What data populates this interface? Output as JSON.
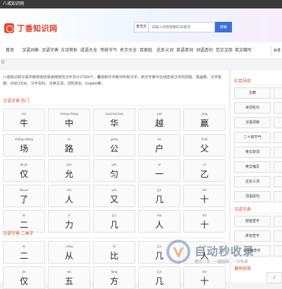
{
  "window": {
    "title": "八戒知识网"
  },
  "header": {
    "logo_text": "丁香知识网",
    "search": {
      "type_label": "查范文",
      "placeholder": "请输入你想搜索的关键词",
      "button_label": "搜索"
    }
  },
  "nav": {
    "items": [
      "首页",
      "汉语词典",
      "汉语字典",
      "古诗赏析",
      "成语大全",
      "传统节气",
      "名字大全",
      "百家姓",
      "近反义词",
      "英语单词",
      "词语造句",
      "范文文库",
      "英文缩写"
    ],
    "right_label": "目录"
  },
  "breadcrumb": "D",
  "main": {
    "intro": "八戒知识网汉语字典频道收录通用规范汉字共计27034个，囊括新华字典中所有汉字。新华字典可在线查阅汉字的拼音、笔画数、汉字笔顺、UNICODE、汉字百科、汉英互译、词性变化、English等。",
    "section1_title": "汉语字典 热门",
    "section2_title": "汉语字典 二画字",
    "grid1": [
      {
        "py": "niú",
        "hz": "牛"
      },
      {
        "py": "zhōng,zhòng",
        "hz": "中"
      },
      {
        "py": "huá,huà,huā",
        "hz": "华"
      },
      {
        "py": "yuè",
        "hz": "越"
      },
      {
        "py": "yíng",
        "hz": "赢"
      },
      {
        "py": "cháng,chǎng",
        "hz": "场"
      },
      {
        "py": "lù",
        "hz": "路"
      },
      {
        "py": "gōng",
        "hz": "公"
      },
      {
        "py": "hù",
        "hz": "户"
      },
      {
        "py": "fù,fǔ",
        "hz": "父"
      },
      {
        "py": "jǐn,jìn",
        "hz": "仅"
      },
      {
        "py": "yǔn",
        "hz": "允"
      },
      {
        "py": "yún",
        "hz": "匀"
      },
      {
        "py": "yī",
        "hz": "一"
      },
      {
        "py": "yǐ",
        "hz": "乙"
      },
      {
        "py": "liǎo,le",
        "hz": "了"
      },
      {
        "py": "rén",
        "hz": "人"
      },
      {
        "py": "yòu",
        "hz": "又"
      },
      {
        "py": "jǐ,jī",
        "hz": "几"
      },
      {
        "py": "shí",
        "hz": "十"
      },
      {
        "py": "èr",
        "hz": "二"
      },
      {
        "py": "lì",
        "hz": "力"
      },
      {
        "py": "jǐ,jī",
        "hz": "几"
      },
      {
        "py": "rén",
        "hz": "人"
      },
      {
        "py": "shí",
        "hz": "十"
      }
    ],
    "grid2": [
      {
        "py": "èr",
        "hz": "二"
      },
      {
        "py": "cóng",
        "hz": "从"
      },
      {
        "py": "bǐ",
        "hz": "比"
      },
      {
        "py": "jǐ,jī",
        "hz": "几"
      },
      {
        "py": "rén",
        "hz": "人"
      },
      {
        "py": "jìn",
        "hz": "仅"
      },
      {
        "py": "wǔ",
        "hz": "五"
      },
      {
        "py": "fāng",
        "hz": "方"
      },
      {
        "py": "jǐ,jī",
        "hz": "几"
      },
      {
        "py": "shí",
        "hz": "十"
      }
    ]
  },
  "sidebar": {
    "nav_title": "栏目导航",
    "nav_items": [
      "古籍",
      "诗词名句",
      "汉语词典",
      "二十四节气",
      "英文单词",
      "英文缩写",
      "近反义词",
      "词语造句"
    ],
    "dict_title": "汉语字典",
    "dict_items": [
      "部首查字",
      "拼音查字",
      "100画查字"
    ],
    "bottom_title": "偏旁部首",
    "bottom_items": [
      "丿"
    ]
  },
  "watermark": {
    "text": "自动秒收录",
    "subtext": "提交一次 · 一键收录 · 一次收录"
  }
}
